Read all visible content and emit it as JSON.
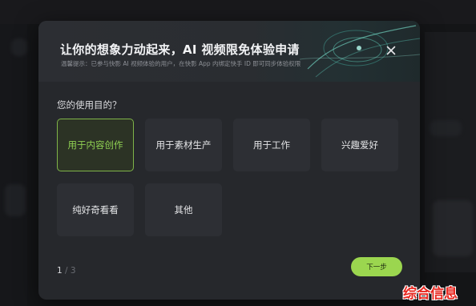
{
  "dialog": {
    "title": "让你的想象力动起来，AI 视频限免体验申请",
    "notice": "温馨提示：已参与快影 AI 视频体验的用户，在快影 App 内绑定快手 ID 即可同步体验权限",
    "close_icon": "close-icon",
    "question": "您的使用目的？",
    "options": [
      {
        "label": "用于内容创作",
        "selected": true
      },
      {
        "label": "用于素材生产",
        "selected": false
      },
      {
        "label": "用于工作",
        "selected": false
      },
      {
        "label": "兴趣爱好",
        "selected": false
      },
      {
        "label": "纯好奇看看",
        "selected": false
      },
      {
        "label": "其他",
        "selected": false
      }
    ],
    "pager": {
      "current": "1",
      "separator": "/",
      "total": "3"
    },
    "next_label": "下一步"
  },
  "watermark": "综合信息",
  "colors": {
    "accent": "#9bd64f",
    "selected_text": "#8fd052",
    "dialog_bg": "#26282c",
    "watermark": "#e7271f"
  }
}
